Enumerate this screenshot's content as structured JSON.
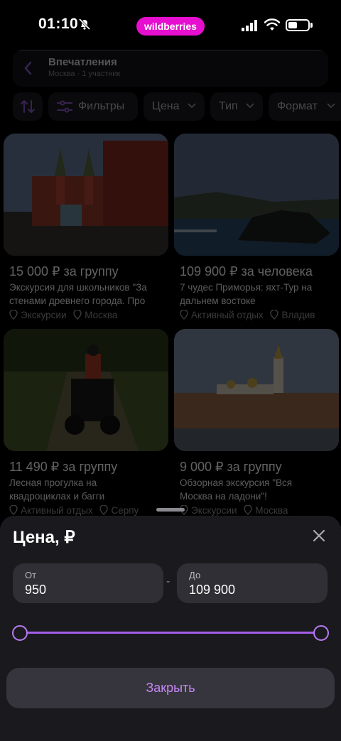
{
  "status_bar": {
    "time": "01:10",
    "brand": "wildberries"
  },
  "header": {
    "title": "Впечатления",
    "subtitle": "Москва · 1 участник"
  },
  "chips": {
    "filters": "Фильтры",
    "price": "Цена",
    "type": "Тип",
    "format": "Формат"
  },
  "cards": [
    {
      "price": "15 000 ₽ за группу",
      "desc_line1": "Экскурсия для школьников \"За",
      "desc_line2": "стенами древнего города. Про",
      "category": "Экскурсии",
      "city": "Москва"
    },
    {
      "price": "109 900 ₽ за человека",
      "desc_line1": "7 чудес Приморья: яхт-Тур на",
      "desc_line2": "дальнем востоке",
      "category": "Активный отдых",
      "city": "Владив"
    },
    {
      "price": "11 490 ₽ за группу",
      "desc_line1": "Лесная прогулка на",
      "desc_line2": "квадроциклах и багги",
      "category": "Активный отдых",
      "city": "Серпу"
    },
    {
      "price": "9 000 ₽ за группу",
      "desc_line1": "Обзорная экскурсия \"Вся",
      "desc_line2": "Москва на ладони\"!",
      "category": "Экскурсии",
      "city": "Москва"
    }
  ],
  "sheet": {
    "title": "Цена, ₽",
    "from_label": "От",
    "from_value": "950",
    "to_label": "До",
    "to_value": "109 900",
    "close_button": "Закрыть"
  },
  "colors": {
    "brand": "#e60fcf",
    "accent": "#b67cf2",
    "sheet_bg": "#1a1a1e"
  }
}
